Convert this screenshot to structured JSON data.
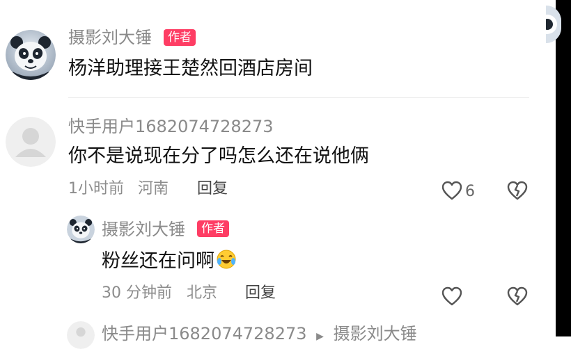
{
  "comments": [
    {
      "username": "摄影刘大锤",
      "badge": "作者",
      "text": "杨洋助理接王楚然回酒店房间"
    },
    {
      "username": "快手用户1682074728273",
      "text": "你不是说现在分了吗怎么还在说他俩",
      "time": "1小时前",
      "location": "河南",
      "reply_label": "回复",
      "like_count": "6"
    }
  ],
  "reply": {
    "username": "摄影刘大锤",
    "badge": "作者",
    "text": "粉丝还在问啊",
    "emoji": "laughing-crying-emoji",
    "time": "30 分钟前",
    "location": "北京",
    "reply_label": "回复"
  },
  "next_reply": {
    "username": "快手用户1682074728273",
    "arrow": "▶",
    "target": "摄影刘大锤"
  },
  "colors": {
    "badge": "#fe3d64",
    "username": "#8a8a8a",
    "meta": "#8c8c8c"
  },
  "icons": [
    "heart-icon",
    "dislike-heart-icon",
    "default-avatar-icon",
    "panda-avatar"
  ]
}
